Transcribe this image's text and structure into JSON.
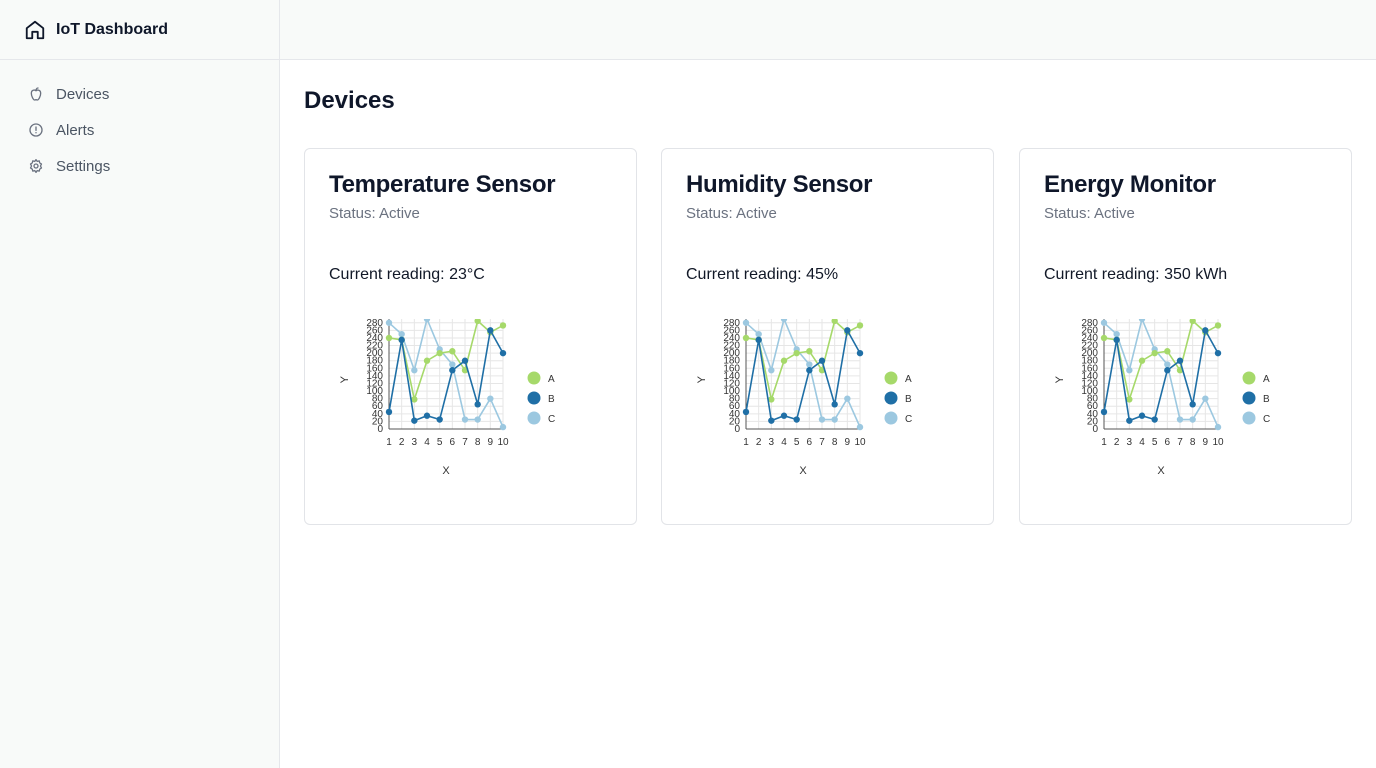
{
  "app": {
    "title": "IoT Dashboard"
  },
  "sidebar": {
    "items": [
      {
        "label": "Devices",
        "icon": "apple-icon"
      },
      {
        "label": "Alerts",
        "icon": "alert-circle-icon"
      },
      {
        "label": "Settings",
        "icon": "gear-icon"
      }
    ]
  },
  "main": {
    "title": "Devices"
  },
  "colors": {
    "A": "#a6d96a",
    "B": "#1f6fa6",
    "C": "#9cc8e0"
  },
  "devices": [
    {
      "title": "Temperature Sensor",
      "status": "Status: Active",
      "reading": "Current reading: 23°C"
    },
    {
      "title": "Humidity Sensor",
      "status": "Status: Active",
      "reading": "Current reading: 45%"
    },
    {
      "title": "Energy Monitor",
      "status": "Status: Active",
      "reading": "Current reading: 350 kWh"
    }
  ],
  "chart_data": [
    {
      "type": "line",
      "xlabel": "X",
      "ylabel": "Y",
      "x": [
        1,
        2,
        3,
        4,
        5,
        6,
        7,
        8,
        9,
        10
      ],
      "ylim": [
        0,
        290
      ],
      "yticks": [
        0,
        20,
        40,
        60,
        80,
        100,
        120,
        140,
        160,
        180,
        200,
        220,
        240,
        260,
        280
      ],
      "series": [
        {
          "name": "A",
          "values": [
            240,
            235,
            78,
            180,
            200,
            205,
            155,
            285,
            255,
            273
          ]
        },
        {
          "name": "B",
          "values": [
            45,
            235,
            22,
            35,
            25,
            155,
            180,
            65,
            260,
            200
          ]
        },
        {
          "name": "C",
          "values": [
            280,
            250,
            155,
            290,
            210,
            170,
            25,
            25,
            80,
            5
          ]
        }
      ]
    },
    {
      "type": "line",
      "xlabel": "X",
      "ylabel": "Y",
      "x": [
        1,
        2,
        3,
        4,
        5,
        6,
        7,
        8,
        9,
        10
      ],
      "ylim": [
        0,
        290
      ],
      "yticks": [
        0,
        20,
        40,
        60,
        80,
        100,
        120,
        140,
        160,
        180,
        200,
        220,
        240,
        260,
        280
      ],
      "series": [
        {
          "name": "A",
          "values": [
            240,
            235,
            78,
            180,
            200,
            205,
            155,
            285,
            255,
            273
          ]
        },
        {
          "name": "B",
          "values": [
            45,
            235,
            22,
            35,
            25,
            155,
            180,
            65,
            260,
            200
          ]
        },
        {
          "name": "C",
          "values": [
            280,
            250,
            155,
            290,
            210,
            170,
            25,
            25,
            80,
            5
          ]
        }
      ]
    },
    {
      "type": "line",
      "xlabel": "X",
      "ylabel": "Y",
      "x": [
        1,
        2,
        3,
        4,
        5,
        6,
        7,
        8,
        9,
        10
      ],
      "ylim": [
        0,
        290
      ],
      "yticks": [
        0,
        20,
        40,
        60,
        80,
        100,
        120,
        140,
        160,
        180,
        200,
        220,
        240,
        260,
        280
      ],
      "series": [
        {
          "name": "A",
          "values": [
            240,
            235,
            78,
            180,
            200,
            205,
            155,
            285,
            255,
            273
          ]
        },
        {
          "name": "B",
          "values": [
            45,
            235,
            22,
            35,
            25,
            155,
            180,
            65,
            260,
            200
          ]
        },
        {
          "name": "C",
          "values": [
            280,
            250,
            155,
            290,
            210,
            170,
            25,
            25,
            80,
            5
          ]
        }
      ]
    }
  ]
}
